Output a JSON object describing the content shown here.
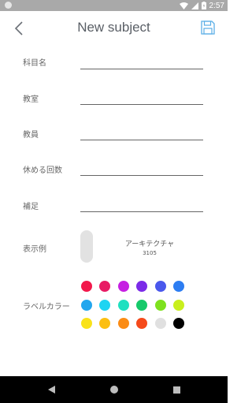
{
  "status_bar": {
    "time": "2:57"
  },
  "app_bar": {
    "title": "New subject"
  },
  "form": {
    "subject_name": {
      "label": "科目名",
      "value": ""
    },
    "classroom": {
      "label": "教室",
      "value": ""
    },
    "teacher": {
      "label": "教員",
      "value": ""
    },
    "absences": {
      "label": "休める回数",
      "value": ""
    },
    "notes": {
      "label": "補足",
      "value": ""
    }
  },
  "preview": {
    "label": "表示例",
    "name": "アーキテクチャ",
    "room": "3105"
  },
  "label_color": {
    "label": "ラベルカラー",
    "colors": [
      "#f2184b",
      "#e81b64",
      "#c61fe2",
      "#7b2be8",
      "#4a58ec",
      "#2d7df2",
      "#22a6ee",
      "#1ed4f2",
      "#1fe0c0",
      "#16c96a",
      "#7ee11e",
      "#c9ef1d",
      "#f9e21a",
      "#fcbf12",
      "#fb8c15",
      "#f54a1b",
      "#e0e0e0",
      "#000000"
    ]
  }
}
